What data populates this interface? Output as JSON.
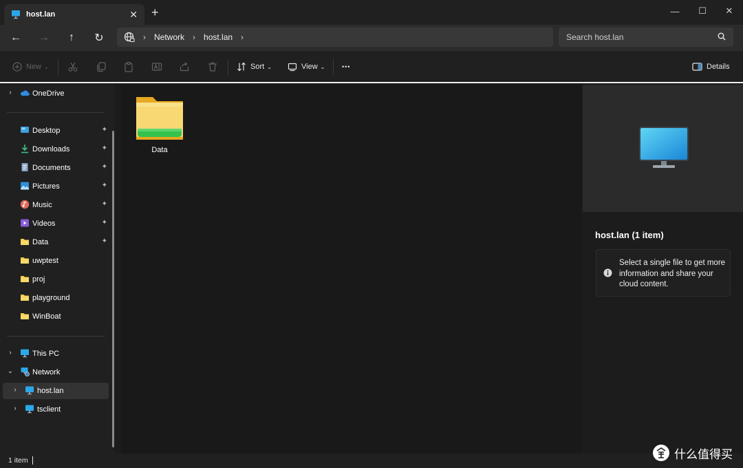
{
  "window": {
    "tab_title": "host.lan",
    "tab_close_glyph": "✕",
    "new_tab_glyph": "+",
    "minimize_glyph": "—",
    "maximize_glyph": "☐",
    "close_glyph": "✕"
  },
  "nav": {
    "back_glyph": "←",
    "forward_glyph": "→",
    "up_glyph": "↑",
    "refresh_glyph": "↻",
    "breadcrumbs": [
      "Network",
      "host.lan"
    ],
    "breadcrumb_separator": "›",
    "search_placeholder": "Search host.lan"
  },
  "toolbar": {
    "new_label": "New",
    "sort_label": "Sort",
    "view_label": "View",
    "more_glyph": "•••",
    "details_label": "Details",
    "caret_glyph": "⌄"
  },
  "sidebar": {
    "onedrive": "OneDrive",
    "quick_access": [
      {
        "label": "Desktop",
        "icon": "desktop-icon",
        "pinned": true
      },
      {
        "label": "Downloads",
        "icon": "download-icon",
        "pinned": true
      },
      {
        "label": "Documents",
        "icon": "document-icon",
        "pinned": true
      },
      {
        "label": "Pictures",
        "icon": "picture-icon",
        "pinned": true
      },
      {
        "label": "Music",
        "icon": "music-icon",
        "pinned": true
      },
      {
        "label": "Videos",
        "icon": "video-icon",
        "pinned": true
      },
      {
        "label": "Data",
        "icon": "folder-icon",
        "pinned": true
      },
      {
        "label": "uwptest",
        "icon": "folder-icon",
        "pinned": false
      },
      {
        "label": "proj",
        "icon": "folder-icon",
        "pinned": false
      },
      {
        "label": "playground",
        "icon": "folder-icon",
        "pinned": false
      },
      {
        "label": "WinBoat",
        "icon": "folder-icon",
        "pinned": false
      }
    ],
    "pin_glyph": "📌",
    "this_pc": "This PC",
    "network": "Network",
    "network_children": [
      "host.lan",
      "tsclient"
    ],
    "chevron_right": "›",
    "chevron_down": "⌄"
  },
  "content": {
    "items": [
      {
        "name": "Data",
        "type": "network-share-folder"
      }
    ]
  },
  "details": {
    "title": "host.lan (1 item)",
    "info_text": "Select a single file to get more information and share your cloud content."
  },
  "status": {
    "item_count": "1 item"
  },
  "watermark": {
    "text": "什么值得买",
    "logo_glyph": "值"
  },
  "colors": {
    "accent_blue": "#2aa8e8",
    "folder_yellow": "#f5c94c",
    "share_green": "#35c24d"
  }
}
